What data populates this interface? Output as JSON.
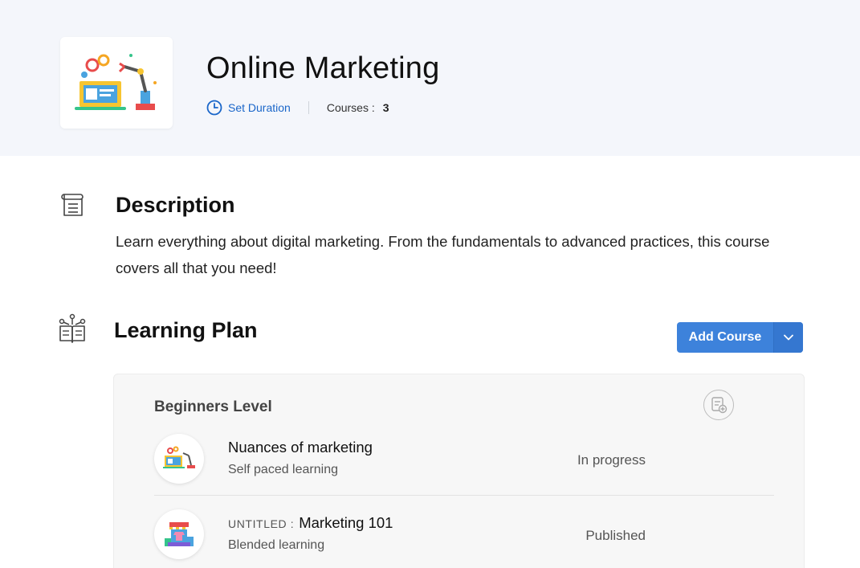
{
  "header": {
    "title": "Online Marketing",
    "set_duration_label": "Set Duration",
    "courses_label": "Courses :",
    "courses_count": "3"
  },
  "description": {
    "heading": "Description",
    "text": "Learn everything about digital marketing. From the fundamentals to advanced practices, this course covers all that you need!"
  },
  "learning_plan": {
    "heading": "Learning Plan",
    "add_course_label": "Add Course",
    "levels": [
      {
        "title": "Beginners Level",
        "courses": [
          {
            "prefix": "",
            "name": "Nuances of marketing",
            "type": "Self paced learning",
            "status": "In progress"
          },
          {
            "prefix": "UNTITLED :",
            "name": "Marketing 101",
            "type": "Blended learning",
            "status": "Published"
          }
        ]
      }
    ]
  },
  "colors": {
    "header_bg": "#f4f6fb",
    "accent": "#1a66c9",
    "button": "#3d82db"
  },
  "icons": [
    "clock-icon",
    "scroll-icon",
    "book-tree-icon",
    "chevron-down-icon",
    "add-list-icon"
  ]
}
